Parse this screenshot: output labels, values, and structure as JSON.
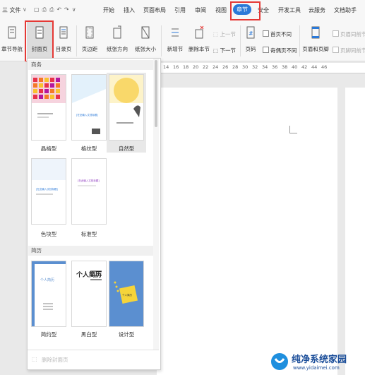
{
  "menubar": {
    "items": [
      {
        "label": "三 文件",
        "name": "menu-file"
      },
      {
        "label": "开始",
        "name": "menu-start"
      },
      {
        "label": "插入",
        "name": "menu-insert"
      },
      {
        "label": "页面布局",
        "name": "menu-page-layout"
      },
      {
        "label": "引用",
        "name": "menu-references"
      },
      {
        "label": "审阅",
        "name": "menu-review"
      },
      {
        "label": "视图",
        "name": "menu-view"
      },
      {
        "label": "章节",
        "name": "menu-section"
      },
      {
        "label": "安全",
        "name": "menu-security"
      },
      {
        "label": "开发工具",
        "name": "menu-developer"
      },
      {
        "label": "云服务",
        "name": "menu-cloud"
      },
      {
        "label": "文档助手",
        "name": "menu-doc-assistant"
      }
    ]
  },
  "ribbon": {
    "chapter_nav": "章节导航",
    "cover_page": "封面页",
    "toc_page": "目录页",
    "margins": "页边距",
    "orientation": "纸张方向",
    "paper_size": "纸张大小",
    "new_section": "新增节",
    "delete_section": "删除本节",
    "prev_section": "上一节",
    "next_section": "下一节",
    "page_number": "页码",
    "first_page_diff": "首页不同",
    "odd_even_diff": "奇偶页不同",
    "header_footer": "页眉和页脚",
    "same_as_prev_header": "页眉同前节",
    "same_as_prev_footer": "页脚同前节"
  },
  "ruler": [
    "14",
    "16",
    "18",
    "20",
    "22",
    "24",
    "26",
    "28",
    "30",
    "32",
    "34",
    "36",
    "38",
    "40",
    "42",
    "44",
    "46"
  ],
  "dropdown": {
    "section_business": "商务",
    "section_resume": "简历",
    "business_items": [
      "晶格型",
      "格纹型",
      "自然型",
      "色块型",
      "标准型"
    ],
    "resume_items": [
      "简约型",
      "黑白型",
      "设计型"
    ],
    "delete_cover": "删除封面页"
  },
  "thumb_text": {
    "business_report": "[在此输入文档标题]",
    "resume_title": "个人简历",
    "resume_big": "个人简历"
  },
  "watermark": {
    "title": "纯净系统家园",
    "url": "www.yidaimei.com"
  },
  "colors": {
    "accent": "#2b79d8",
    "highlight_red": "#e53935",
    "resume_blue": "#5b8fd0"
  }
}
